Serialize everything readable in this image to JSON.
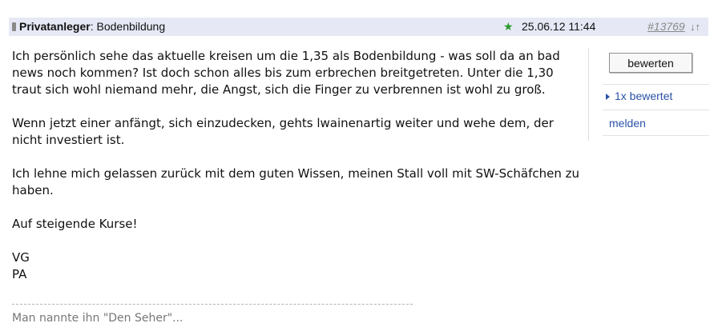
{
  "header": {
    "username": "Privatanleger",
    "separator": ":",
    "subject": "Bodenbildung",
    "date": "25.06.12 11:44",
    "post_id": "#13769",
    "arrow_down": "↓",
    "arrow_up": "↑",
    "icons": [
      "user-icon",
      "star-icon"
    ],
    "star_color": "#2a9a2a",
    "bar_color": "#e6e9f5"
  },
  "post": {
    "paragraphs": [
      "Ich persönlich sehe das aktuelle kreisen um die 1,35 als Bodenbildung - was soll da an bad\nnews noch kommen? Ist doch schon alles bis zum erbrechen breitgetreten. Unter die 1,30\ntraut sich wohl niemand mehr, die Angst, sich die Finger zu verbrennen ist wohl zu groß.",
      "Wenn jetzt einer anfängt, sich einzudecken, gehts lwainenartig weiter und wehe dem, der\nnicht investiert ist.",
      "Ich lehne mich gelassen zurück mit dem guten Wissen, meinen Stall voll mit SW-Schäfchen zu\nhaben.",
      "Auf steigende Kurse!",
      "VG\nPA"
    ],
    "signature": "Man nannte ihn \"Den Seher\"..."
  },
  "sidebar": {
    "rate_button": "bewerten",
    "rated_count": "1x bewertet",
    "report_link": "melden",
    "link_color": "#2b52a8"
  }
}
